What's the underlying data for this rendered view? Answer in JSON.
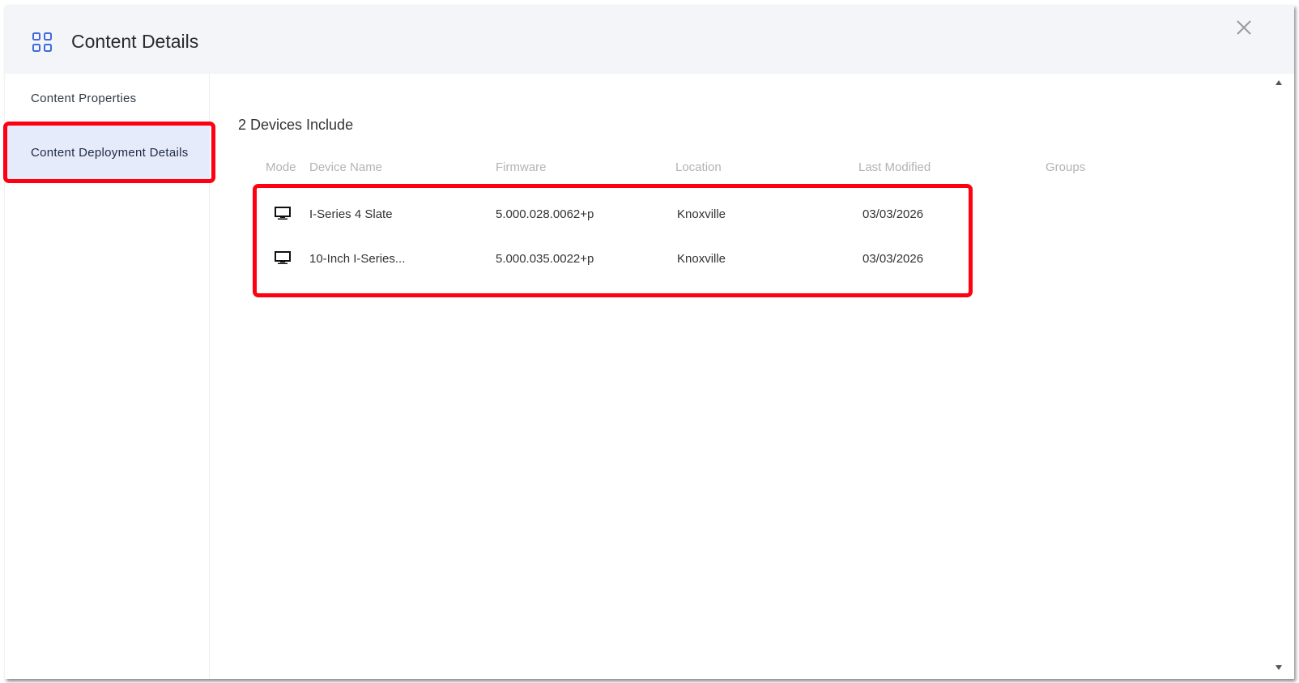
{
  "dialog": {
    "title": "Content Details",
    "header_icon": "grid-icon",
    "close_icon": "close-icon"
  },
  "sidebar": {
    "items": [
      {
        "label": "Content Properties",
        "active": false
      },
      {
        "label": "Content Deployment Details",
        "active": true
      }
    ]
  },
  "main": {
    "device_count_text": "2 Devices Include",
    "table": {
      "headers": [
        "Mode",
        "Device Name",
        "Firmware",
        "Location",
        "Last Modified",
        "Groups"
      ],
      "rows": [
        {
          "mode_icon": "monitor-icon",
          "device_name": "I-Series 4 Slate",
          "firmware": "5.000.028.0062+p",
          "location": "Knoxville",
          "last_modified": "03/03/2026",
          "groups": ""
        },
        {
          "mode_icon": "monitor-icon",
          "device_name": "10-Inch I-Series...",
          "firmware": "5.000.035.0022+p",
          "location": "Knoxville",
          "last_modified": "03/03/2026",
          "groups": ""
        }
      ]
    }
  },
  "colors": {
    "accent_blue": "#3f6ad8",
    "highlight_red": "#ff0010",
    "active_bg": "#e5ebfb",
    "header_bg": "#f4f5f8"
  }
}
